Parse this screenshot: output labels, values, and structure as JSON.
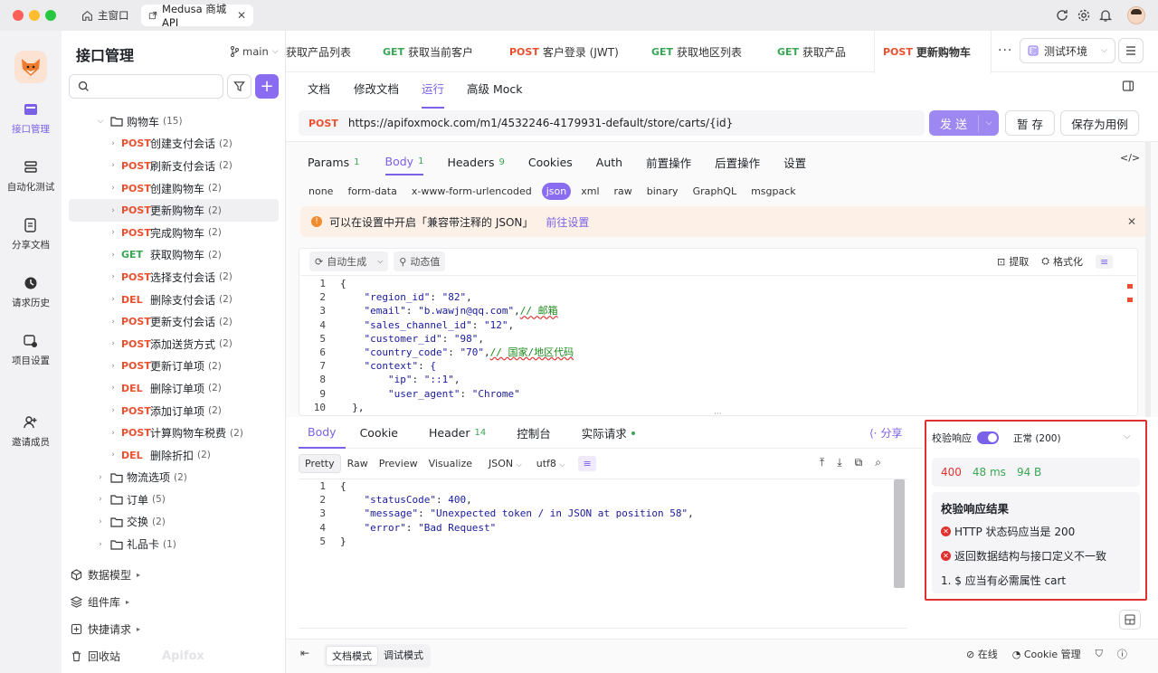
{
  "window": {
    "tabs": [
      {
        "label": "主窗口"
      },
      {
        "label": "Medusa 商城 API"
      }
    ]
  },
  "rail": {
    "items": [
      {
        "label": "接口管理",
        "active": true
      },
      {
        "label": "自动化测试"
      },
      {
        "label": "分享文档"
      },
      {
        "label": "请求历史"
      },
      {
        "label": "项目设置"
      },
      {
        "label": "邀请成员"
      }
    ]
  },
  "sidebar": {
    "title": "接口管理",
    "branch": "main",
    "search_placeholder": "",
    "folder": {
      "label": "购物车",
      "count": "(15)"
    },
    "items": [
      {
        "method": "POST",
        "label": "创建支付会话",
        "count": "(2)"
      },
      {
        "method": "POST",
        "label": "刷新支付会话",
        "count": "(2)"
      },
      {
        "method": "POST",
        "label": "创建购物车",
        "count": "(2)"
      },
      {
        "method": "POST",
        "label": "更新购物车",
        "count": "(2)",
        "selected": true
      },
      {
        "method": "POST",
        "label": "完成购物车",
        "count": "(2)"
      },
      {
        "method": "GET",
        "label": "获取购物车",
        "count": "(2)"
      },
      {
        "method": "POST",
        "label": "选择支付会话",
        "count": "(2)"
      },
      {
        "method": "DEL",
        "label": "删除支付会话",
        "count": "(2)"
      },
      {
        "method": "POST",
        "label": "更新支付会话",
        "count": "(2)"
      },
      {
        "method": "POST",
        "label": "添加送货方式",
        "count": "(2)"
      },
      {
        "method": "POST",
        "label": "更新订单项",
        "count": "(2)"
      },
      {
        "method": "DEL",
        "label": "删除订单项",
        "count": "(2)"
      },
      {
        "method": "POST",
        "label": "添加订单项",
        "count": "(2)"
      },
      {
        "method": "POST",
        "label": "计算购物车税费",
        "count": "(2)"
      },
      {
        "method": "DEL",
        "label": "删除折扣",
        "count": "(2)"
      }
    ],
    "folders": [
      {
        "label": "物流选项",
        "count": "(2)"
      },
      {
        "label": "订单",
        "count": "(5)"
      },
      {
        "label": "交换",
        "count": "(2)"
      },
      {
        "label": "礼品卡",
        "count": "(1)"
      }
    ],
    "footer": [
      {
        "label": "数据模型"
      },
      {
        "label": "组件库"
      },
      {
        "label": "快捷请求"
      },
      {
        "label": "回收站"
      }
    ],
    "brand": "Apifox"
  },
  "request_tabs": [
    {
      "method": "",
      "label": "获取产品列表"
    },
    {
      "method": "GET",
      "label": "获取当前客户"
    },
    {
      "method": "POST",
      "label": "客户登录 (JWT)"
    },
    {
      "method": "GET",
      "label": "获取地区列表"
    },
    {
      "method": "GET",
      "label": "获取产品"
    },
    {
      "method": "POST",
      "label": "更新购物车",
      "active": true
    }
  ],
  "env": {
    "label": "测试环境"
  },
  "doc_tabs": [
    {
      "label": "文档"
    },
    {
      "label": "修改文档"
    },
    {
      "label": "运行",
      "active": true
    },
    {
      "label": "高级 Mock"
    }
  ],
  "url_bar": {
    "method": "POST",
    "url": "https://apifoxmock.com/m1/4532246-4179931-default/store/carts/{id}",
    "send": "发 送",
    "save": "暂 存",
    "save_case": "保存为用例"
  },
  "param_tabs": [
    {
      "label": "Params",
      "badge": "1"
    },
    {
      "label": "Body",
      "badge": "1",
      "active": true
    },
    {
      "label": "Headers",
      "badge": "9"
    },
    {
      "label": "Cookies",
      "badge": ""
    },
    {
      "label": "Auth",
      "badge": ""
    },
    {
      "label": "前置操作",
      "badge": ""
    },
    {
      "label": "后置操作",
      "badge": ""
    },
    {
      "label": "设置",
      "badge": ""
    }
  ],
  "body_types": [
    "none",
    "form-data",
    "x-www-form-urlencoded",
    "json",
    "xml",
    "raw",
    "binary",
    "GraphQL",
    "msgpack"
  ],
  "body_type_active": "json",
  "notice": {
    "text": "可以在设置中开启「兼容带注释的 JSON」",
    "link": "前往设置"
  },
  "editor_toolbar": {
    "auto": "自动生成",
    "dynamic": "动态值",
    "extract": "提取",
    "format": "格式化"
  },
  "request_body_lines": [
    {
      "n": "1",
      "text": "{"
    },
    {
      "n": "2",
      "key": "\"region_id\"",
      "val": "\"82\"",
      "tail": ",",
      "comment": ""
    },
    {
      "n": "3",
      "key": "\"email\"",
      "val": "\"b.wawjn@qq.com\"",
      "tail": ",",
      "comment": "// 邮箱"
    },
    {
      "n": "4",
      "key": "\"sales_channel_id\"",
      "val": "\"12\"",
      "tail": ",",
      "comment": ""
    },
    {
      "n": "5",
      "key": "\"customer_id\"",
      "val": "\"98\"",
      "tail": ",",
      "comment": ""
    },
    {
      "n": "6",
      "key": "\"country_code\"",
      "val": "\"70\"",
      "tail": ",",
      "comment": "// 国家/地区代码"
    },
    {
      "n": "7",
      "key": "\"context\"",
      "val": "{",
      "tail": "",
      "comment": ""
    },
    {
      "n": "8",
      "key": "\"ip\"",
      "val": "\"::1\"",
      "tail": ",",
      "comment": "",
      "indent": 2
    },
    {
      "n": "9",
      "key": "\"user_agent\"",
      "val": "\"Chrome\"",
      "tail": "",
      "comment": "",
      "indent": 2
    },
    {
      "n": "10",
      "text": "  },"
    }
  ],
  "response_tabs": [
    {
      "label": "Body",
      "active": true,
      "badge": ""
    },
    {
      "label": "Cookie",
      "badge": ""
    },
    {
      "label": "Header",
      "badge": "14"
    },
    {
      "label": "控制台",
      "badge": ""
    },
    {
      "label": "实际请求",
      "badge": ""
    }
  ],
  "share": "分享",
  "response_toolbar": {
    "modes": [
      "Pretty",
      "Raw",
      "Preview",
      "Visualize"
    ],
    "format": "JSON",
    "encoding": "utf8"
  },
  "response_lines": [
    {
      "n": "1",
      "text": "{"
    },
    {
      "n": "2",
      "key": "\"statusCode\"",
      "val": "400",
      "tail": ","
    },
    {
      "n": "3",
      "key": "\"message\"",
      "val": "\"Unexpected token / in JSON at position 58\"",
      "tail": ","
    },
    {
      "n": "4",
      "key": "\"error\"",
      "val": "\"Bad Request\"",
      "tail": ""
    },
    {
      "n": "5",
      "text": "}"
    }
  ],
  "validation": {
    "toggle_label": "校验响应",
    "status_select": "正常 (200)",
    "status_code": "400",
    "time": "48 ms",
    "size": "94 B",
    "result_title": "校验响应结果",
    "errors": [
      "HTTP 状态码应当是 200",
      "返回数据结构与接口定义不一致"
    ],
    "detail": "1. $ 应当有必需属性 cart",
    "highlight_color": "#e0312f"
  },
  "bottom_bar": {
    "modes": [
      "文档模式",
      "调试模式"
    ],
    "online": "在线",
    "cookie": "Cookie 管理"
  },
  "colors": {
    "accent": "#7b61e8",
    "post": "#e8502f",
    "get": "#3aa655"
  }
}
